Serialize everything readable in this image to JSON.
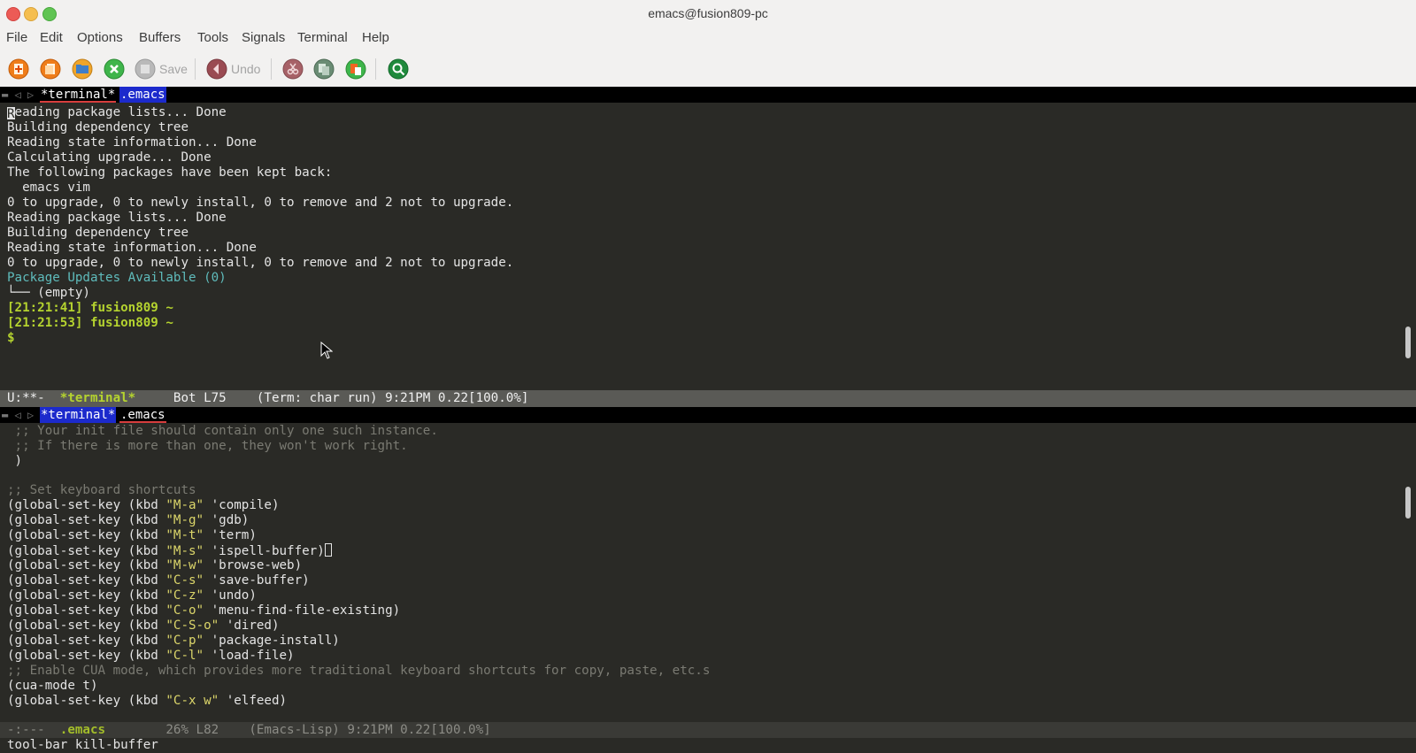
{
  "window": {
    "title": "emacs@fusion809-pc"
  },
  "menu": [
    "File",
    "Edit",
    "Options",
    "Buffers",
    "Tools",
    "Signals",
    "Terminal",
    "Help"
  ],
  "toolbar": {
    "new_icon": "new-file-icon",
    "open_icon": "open-file-icon",
    "dired_icon": "folder-icon",
    "kill_icon": "close-buffer-icon",
    "save_label": "Save",
    "undo_label": "Undo",
    "cut_icon": "cut-icon",
    "copy_icon": "copy-icon",
    "paste_icon": "paste-icon",
    "search_icon": "search-icon"
  },
  "tabs_top": {
    "controls": "▬ ◁ ▷",
    "terminal": "*terminal*",
    "emacs": ".emacs"
  },
  "tabs_bottom": {
    "controls": "▬ ◁ ▷",
    "terminal": "*terminal*",
    "emacs": ".emacs"
  },
  "terminal": {
    "first_char": "R",
    "first_rest": "eading package lists... Done",
    "lines": [
      "Building dependency tree",
      "Reading state information... Done",
      "Calculating upgrade... Done",
      "The following packages have been kept back:",
      "  emacs vim",
      "0 to upgrade, 0 to newly install, 0 to remove and 2 not to upgrade.",
      "Reading package lists... Done",
      "Building dependency tree",
      "Reading state information... Done",
      "0 to upgrade, 0 to newly install, 0 to remove and 2 not to upgrade."
    ],
    "updates_line": "Package Updates Available (0)",
    "empty_line": "└── (empty)",
    "prompt1": "[21:21:41] fusion809 ~",
    "prompt2": "[21:21:53] fusion809 ~",
    "prompt3": "$"
  },
  "modeline_top": {
    "state": "U:**-  ",
    "buffer": "*terminal*",
    "info": "     Bot L75    (Term: char run) 9:21PM 0.22[100.0%]"
  },
  "code": {
    "comment1": " ;; Your init file should contain only one such instance.",
    "comment2": " ;; If there is more than one, they won't work right.",
    "close_paren": " )",
    "comment3": ";; Set keyboard shortcuts",
    "bindings": [
      {
        "key": "\"M-a\"",
        "cmd": "'compile)"
      },
      {
        "key": "\"M-g\"",
        "cmd": "'gdb)"
      },
      {
        "key": "\"M-t\"",
        "cmd": "'term)"
      },
      {
        "key": "\"M-s\"",
        "cmd": "'ispell-buffer)"
      },
      {
        "key": "\"M-w\"",
        "cmd": "'browse-web)"
      },
      {
        "key": "\"C-s\"",
        "cmd": "'save-buffer)"
      },
      {
        "key": "\"C-z\"",
        "cmd": "'undo)"
      },
      {
        "key": "\"C-o\"",
        "cmd": "'menu-find-file-existing)"
      },
      {
        "key": "\"C-S-o\"",
        "cmd": "'dired)"
      },
      {
        "key": "\"C-p\"",
        "cmd": "'package-install)"
      },
      {
        "key": "\"C-l\"",
        "cmd": "'load-file)"
      }
    ],
    "binding_prefix": "(global-set-key (kbd ",
    "comment4": ";; Enable CUA mode, which provides more traditional keyboard shortcuts for copy, paste, etc.s",
    "cua": "(cua-mode t)",
    "last_binding": {
      "key": "\"C-x w\"",
      "cmd": "'elfeed)"
    }
  },
  "modeline_bottom": {
    "state": "-:---  ",
    "buffer": ".emacs",
    "info": "        26% L82    (Emacs-Lisp) 9:21PM 0.22[100.0%]"
  },
  "minibuffer": "tool-bar kill-buffer",
  "colors": {
    "prompt": "#b5d32f",
    "updates": "#5fbcbc",
    "comment": "#7a7a72",
    "string": "#dcd66a",
    "buffer_name": "#b5d32f"
  }
}
